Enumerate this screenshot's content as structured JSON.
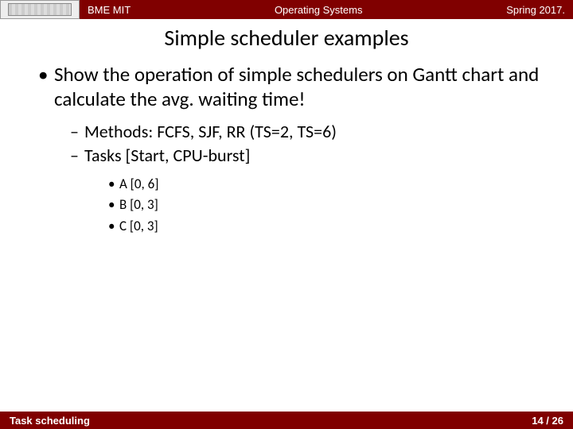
{
  "header": {
    "left": "BME MIT",
    "center": "Operating Systems",
    "right": "Spring 2017."
  },
  "title": "Simple scheduler examples",
  "main_bullet": "Show the operation of simple schedulers on Gantt chart and calculate the avg. waiting time!",
  "sub": {
    "methods": "Methods: FCFS, SJF, RR (TS=2, TS=6)",
    "tasks": "Tasks [Start, CPU-burst]"
  },
  "task_items": {
    "a": "A [0, 6]",
    "b": "B [0, 3]",
    "c": "C [0, 3]"
  },
  "footer": {
    "left": "Task scheduling",
    "right": "14 / 26"
  }
}
